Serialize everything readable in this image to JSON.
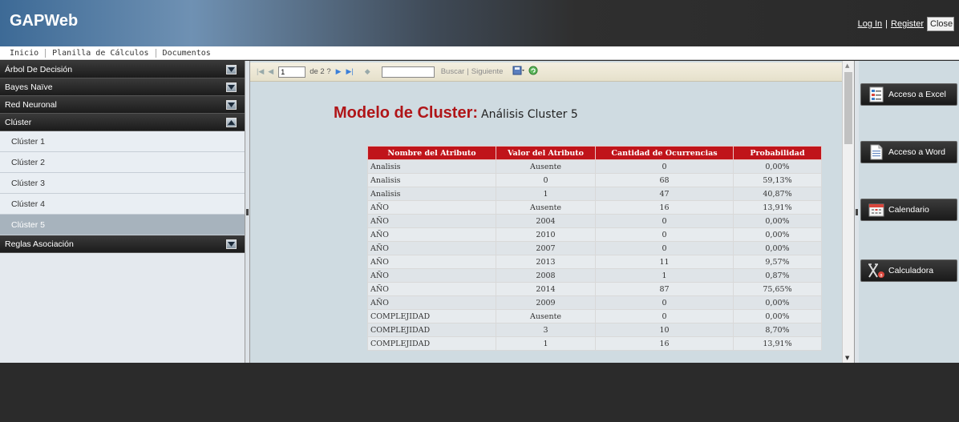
{
  "header": {
    "title": "GAPWeb",
    "login": "Log In",
    "separator": "|",
    "register": "Register",
    "close": "Close"
  },
  "menu": {
    "items": [
      "Inicio",
      "Planilla de Cálculos",
      "Documentos"
    ]
  },
  "sidebar": {
    "sections": [
      {
        "label": "Árbol De Decisión"
      },
      {
        "label": "Bayes Naïve"
      },
      {
        "label": "Red Neuronal"
      },
      {
        "label": "Clúster"
      },
      {
        "label": "Reglas Asociación"
      }
    ],
    "cluster_items": [
      "Clúster 1",
      "Clúster 2",
      "Clúster 3",
      "Clúster 4",
      "Clúster 5"
    ],
    "selected": "Clúster 5"
  },
  "toolbar": {
    "page_value": "1",
    "page_of": "de 2 ?",
    "search_value": "",
    "find_label": "Buscar",
    "next_label": "Siguiente"
  },
  "report": {
    "title": "Modelo de Cluster:",
    "subtitle": "Análisis Cluster 5",
    "columns": [
      "Nombre del Atributo",
      "Valor del Atributo",
      "Cantidad de Ocurrencias",
      "Probabilidad"
    ],
    "rows": [
      [
        "Analisis",
        "Ausente",
        "0",
        "0,00%"
      ],
      [
        "Analisis",
        "0",
        "68",
        "59,13%"
      ],
      [
        "Analisis",
        "1",
        "47",
        "40,87%"
      ],
      [
        "AÑO",
        "Ausente",
        "16",
        "13,91%"
      ],
      [
        "AÑO",
        "2004",
        "0",
        "0,00%"
      ],
      [
        "AÑO",
        "2010",
        "0",
        "0,00%"
      ],
      [
        "AÑO",
        "2007",
        "0",
        "0,00%"
      ],
      [
        "AÑO",
        "2013",
        "11",
        "9,57%"
      ],
      [
        "AÑO",
        "2008",
        "1",
        "0,87%"
      ],
      [
        "AÑO",
        "2014",
        "87",
        "75,65%"
      ],
      [
        "AÑO",
        "2009",
        "0",
        "0,00%"
      ],
      [
        "COMPLEJIDAD",
        "Ausente",
        "0",
        "0,00%"
      ],
      [
        "COMPLEJIDAD",
        "3",
        "10",
        "8,70%"
      ],
      [
        "COMPLEJIDAD",
        "1",
        "16",
        "13,91%"
      ]
    ]
  },
  "right_panel": {
    "buttons": [
      "Acceso a Excel",
      "Acceso a Word",
      "Calendario",
      "Calculadora"
    ]
  },
  "colors": {
    "accent_red": "#c0141a",
    "title_red": "#b01518",
    "dark_bar": "#1c1c1c",
    "selected_item": "#a7b3bd"
  }
}
